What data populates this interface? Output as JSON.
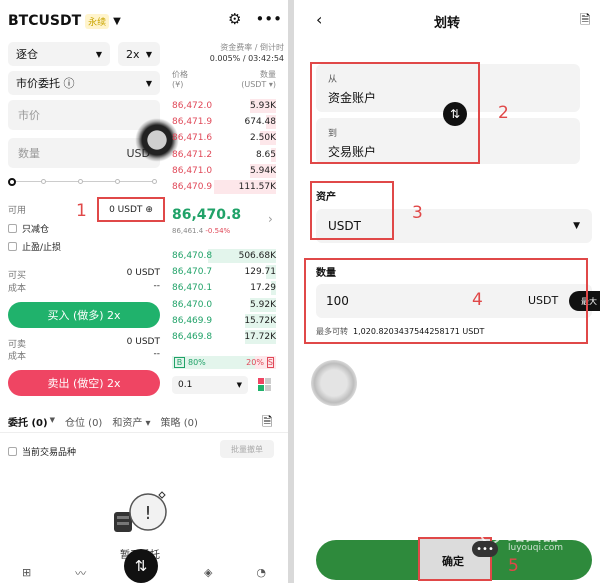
{
  "left": {
    "pair": "BTCUSDT",
    "perp_badge": "永续",
    "margin_mode": "逐仓",
    "leverage": "2x",
    "order_type": "市价委托",
    "funding_label": "资金费率 / 倒计时",
    "funding_value": "0.005% / 03:42:54",
    "book_price_header": "价格",
    "book_price_unit": "(¥)",
    "book_qty_header": "数量",
    "book_qty_unit": "(USDT ▾)",
    "price_placeholder": "市价",
    "qty_placeholder": "数量",
    "qty_unit": "USD",
    "available_label": "可用",
    "available_value": "0 USDT",
    "reduce_only": "只减仓",
    "tp_sl": "止盈/止损",
    "can_buy_label": "可买",
    "can_buy_value": "0 USDT",
    "cost_label": "成本",
    "cost_value": "--",
    "buy_button": "买入 (做多) 2x",
    "can_sell_label": "可卖",
    "can_sell_value": "0 USDT",
    "cost2_label": "成本",
    "cost2_value": "--",
    "sell_button": "卖出 (做空) 2x",
    "asks": [
      {
        "price": "86,472.0",
        "qty": "5.93K",
        "depth": 0.25
      },
      {
        "price": "86,471.9",
        "qty": "674.48",
        "depth": 0.1
      },
      {
        "price": "86,471.6",
        "qty": "2.50K",
        "depth": 0.15
      },
      {
        "price": "86,471.2",
        "qty": "8.65",
        "depth": 0.05
      },
      {
        "price": "86,471.0",
        "qty": "5.94K",
        "depth": 0.25
      },
      {
        "price": "86,470.9",
        "qty": "111.57K",
        "depth": 0.6
      }
    ],
    "last_price": "86,470.8",
    "mark_price": "86,461.4",
    "change": "-0.54%",
    "bids": [
      {
        "price": "86,470.8",
        "qty": "506.68K",
        "depth": 0.65
      },
      {
        "price": "86,470.7",
        "qty": "129.71",
        "depth": 0.1
      },
      {
        "price": "86,470.1",
        "qty": "17.29",
        "depth": 0.05
      },
      {
        "price": "86,470.0",
        "qty": "5.92K",
        "depth": 0.25
      },
      {
        "price": "86,469.9",
        "qty": "15.72K",
        "depth": 0.3
      },
      {
        "price": "86,469.8",
        "qty": "17.72K",
        "depth": 0.3
      }
    ],
    "buy_tag": "B",
    "buy_ratio": "80%",
    "buy_ratio_frac": 0.8,
    "sell_tag": "S",
    "sell_ratio": "20%",
    "depth_value": "0.1",
    "tab_orders": "委托 (0)",
    "tab_positions": "仓位 (0)",
    "tab_assets": "和资产",
    "tab_strategy": "策略 (0)",
    "current_pair_only": "当前交易品种",
    "batch_cancel": "批量撤单",
    "empty_text": "暂无委托",
    "annotation_1": "1",
    "colors": {
      "buy": "#20b26c",
      "sell": "#ef4563",
      "annotation": "#e04848"
    }
  },
  "right": {
    "title": "划转",
    "from_label": "从",
    "from_value": "资金账户",
    "to_label": "到",
    "to_value": "交易账户",
    "asset_label": "资产",
    "asset_value": "USDT",
    "amount_label": "数量",
    "amount_value": "100",
    "amount_unit": "USDT",
    "max_button": "最大",
    "max_transfer_label": "最多可转",
    "max_transfer_value": "1,020.8203437544258171 USDT",
    "confirm_button": "确定",
    "annotation_2": "2",
    "annotation_3": "3",
    "annotation_4": "4",
    "annotation_5": "5",
    "watermark_cn": "路由器",
    "watermark_url": "luyouqi.com",
    "confirm_color": "#2e8a3c"
  }
}
